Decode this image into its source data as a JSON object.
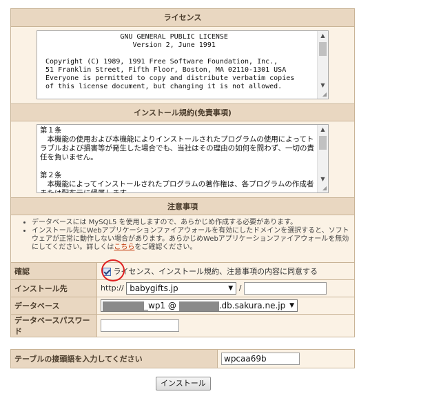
{
  "license": {
    "heading": "ライセンス",
    "text": "                   GNU GENERAL PUBLIC LICENSE\n                      Version 2, June 1991\n\n Copyright (C) 1989, 1991 Free Software Foundation, Inc.,\n 51 Franklin Street, Fifth Floor, Boston, MA 02110-1301 USA\n Everyone is permitted to copy and distribute verbatim copies\n of this license document, but changing it is not allowed."
  },
  "terms": {
    "heading": "インストール規約(免責事項)",
    "line1": "第１条",
    "line2": "　本機能の使用および本機能によりインストールされたプログラムの使用によってトラブルおよび損害等が発生した場合でも、当社はその理由の如何を問わず、一切の責任を負いません。",
    "line3": "第２条",
    "line4": "　本機能によってインストールされたプログラムの著作権は、各プログラムの作成者または配布元に帰属します。"
  },
  "notes": {
    "heading": "注意事項",
    "item1": "データベースには MySQL5 を使用しますので、あらかじめ作成する必要があります。",
    "item2_before": "インストール先にWebアプリケーションファイアウォールを有効にしたドメインを選択すると、ソフトウェアが正常に動作しない場合があります。あらかじめWebアプリケーションファイアウォールを無効にしてください。詳しくは",
    "item2_link": "こちら",
    "item2_after": "をご確認ください。"
  },
  "form": {
    "confirm_label": "確認",
    "confirm_text": "ライセンス、インストール規約、注意事項の内容に同意する",
    "confirm_checked": true,
    "install_label": "インストール先",
    "protocol": "http://",
    "domain_selected": "babygifts.jp",
    "slash": "/",
    "path_value": "",
    "db_label": "データベース",
    "db_name_suffix": "_wp1 @",
    "db_host_suffix": ".db.sakura.ne.jp",
    "db_password_label": "データベースパスワード",
    "db_password_value": ""
  },
  "prefix": {
    "label": "テーブルの接頭語を入力してください",
    "value": "wpcaa69b"
  },
  "install_button": "インストール"
}
